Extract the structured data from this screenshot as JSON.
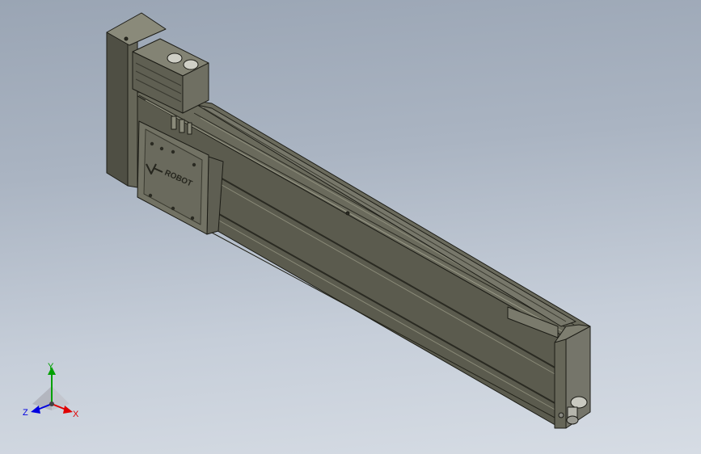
{
  "viewport": {
    "model": "linear-actuator-module",
    "carriage_logo": "ROBOT",
    "colors": {
      "background_top": "#9aa5b4",
      "background_bottom": "#d6dce4",
      "body_dark": "#55554a",
      "body_mid": "#6e6e60",
      "body_light": "#8a8a7a",
      "edge": "#1c1c16"
    }
  },
  "triad": {
    "y_label": "Y",
    "x_label": "X",
    "z_label": "Z",
    "colors": {
      "x": "#e00000",
      "y": "#00a000",
      "z": "#0000e0"
    }
  }
}
